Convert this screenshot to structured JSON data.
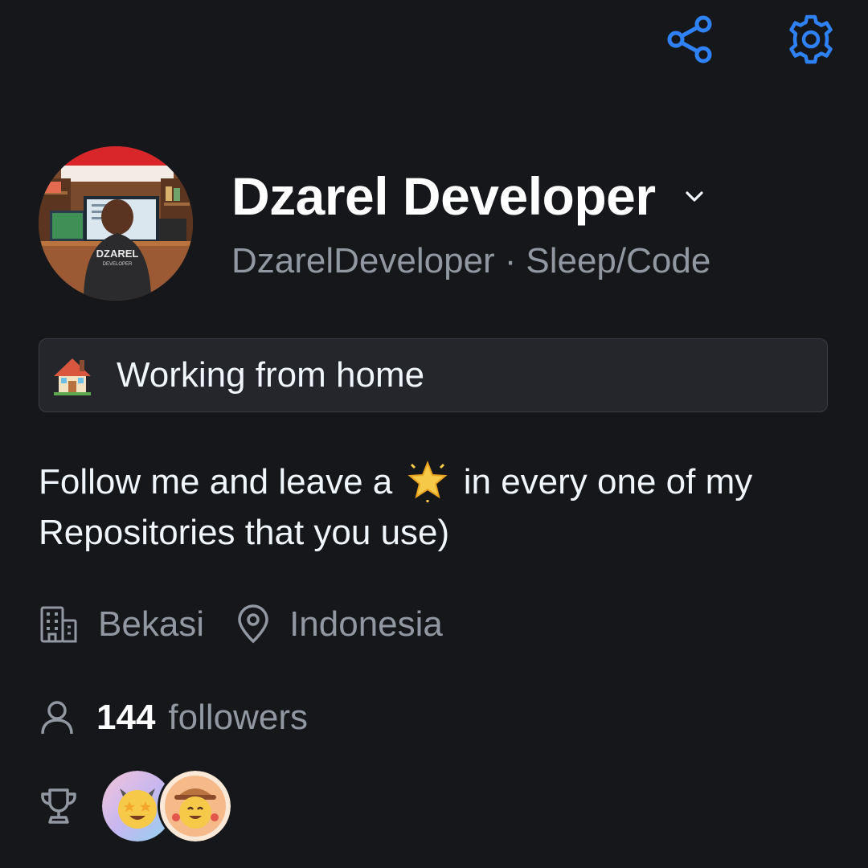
{
  "header": {
    "icons": [
      "share-icon",
      "gear-icon"
    ],
    "accent": "#2f81f7"
  },
  "profile": {
    "display_name": "Dzarel Developer",
    "username": "DzarelDeveloper",
    "separator": "·",
    "pronouns": "Sleep/Code",
    "avatar_text": "DZAREL",
    "avatar_subtext": "DEVELOPER"
  },
  "status": {
    "emoji": "house-icon",
    "text": "Working from home"
  },
  "bio": {
    "before": "Follow me and leave a",
    "emoji": "star-icon",
    "after": "in every one of my Repositories that you use)"
  },
  "location": {
    "company": "Bekasi",
    "place": "Indonesia"
  },
  "followers": {
    "count": "144",
    "label": "followers"
  },
  "achievements": {
    "badges": [
      "starstruck-badge",
      "pair-extraordinaire-badge"
    ]
  },
  "colors": {
    "background": "#16171b",
    "muted": "#9198a1",
    "text": "#f0f6fc",
    "status_bg": "#25262c"
  }
}
